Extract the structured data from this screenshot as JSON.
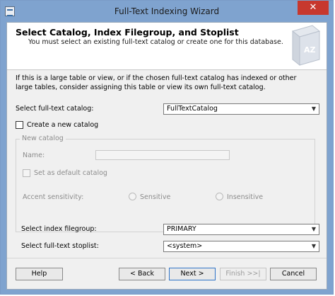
{
  "window": {
    "title": "Full-Text Indexing Wizard",
    "close_label": "✕"
  },
  "header": {
    "title": "Select Catalog, Index Filegroup, and Stoplist",
    "subtitle": "You must select an existing full-text catalog or create one for this database.",
    "icon_text": "AZ"
  },
  "info": {
    "text": "If this is a large table or view, or if the chosen full-text catalog has indexed or other large tables, consider assigning this table or view its own full-text catalog."
  },
  "catalog": {
    "label": "Select full-text catalog:",
    "value": "FullTextCatalog"
  },
  "create_new": {
    "label": "Create a new catalog"
  },
  "new_catalog": {
    "legend": "New catalog",
    "name_label": "Name:",
    "default_label": "Set as default catalog",
    "accent_label": "Accent sensitivity:",
    "sensitive_label": "Sensitive",
    "insensitive_label": "Insensitive"
  },
  "filegroup": {
    "label": "Select index filegroup:",
    "value": "PRIMARY"
  },
  "stoplist": {
    "label": "Select full-text stoplist:",
    "value": "<system>"
  },
  "buttons": {
    "help": "Help",
    "back": "< Back",
    "next": "Next >",
    "finish": "Finish >>|",
    "cancel": "Cancel"
  },
  "colors": {
    "titlebar": "#7fa3cf",
    "close": "#c7382e",
    "focus": "#2f74c7"
  }
}
